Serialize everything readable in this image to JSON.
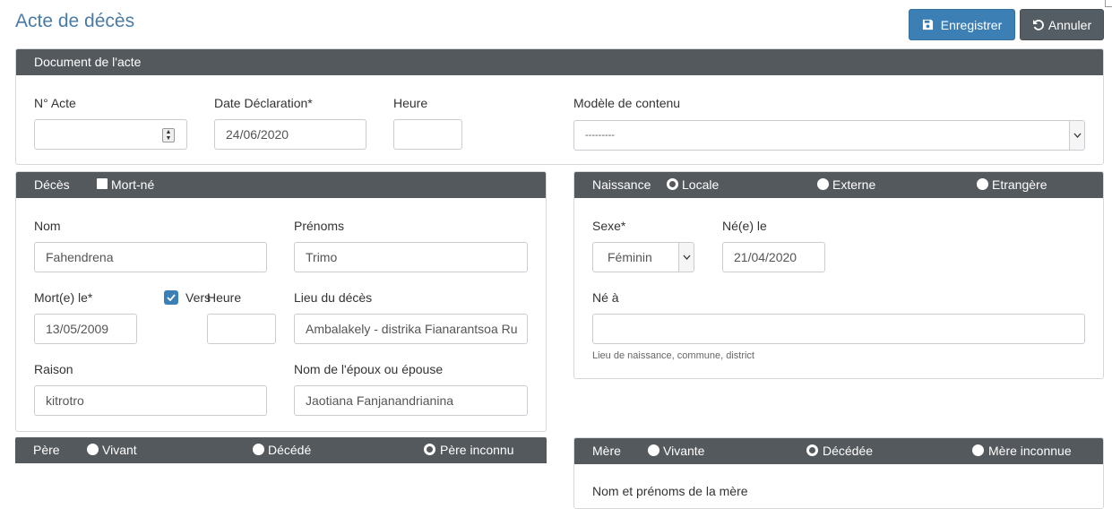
{
  "header": {
    "title": "Acte de décès",
    "save_label": "Enregistrer",
    "cancel_label": "Annuler"
  },
  "document_panel": {
    "title": "Document de l'acte",
    "num_acte_label": "N° Acte",
    "num_acte_value": "",
    "date_label": "Date Déclaration*",
    "date_value": "24/06/2020",
    "heure_label": "Heure",
    "heure_value": "",
    "modele_label": "Modèle de contenu",
    "modele_value": "---------"
  },
  "deces_panel": {
    "title": "Décès",
    "mort_ne_label": "Mort-né",
    "nom_label": "Nom",
    "nom_value": "Fahendrena",
    "prenoms_label": "Prénoms",
    "prenoms_value": "Trimo",
    "mort_le_label": "Mort(e) le*",
    "mort_le_value": "13/05/2009",
    "vers_label": "Vers",
    "heure_label": "Heure",
    "heure_value": "",
    "lieu_label": "Lieu du décès",
    "lieu_value": "Ambalakely - distrika Fianarantsoa Ru",
    "raison_label": "Raison",
    "raison_value": "kitrotro",
    "epoux_label": "Nom de l'époux ou épouse",
    "epoux_value": "Jaotiana Fanjanandrianina"
  },
  "naissance_panel": {
    "title": "Naissance",
    "radio_locale": "Locale",
    "radio_externe": "Externe",
    "radio_etrangere": "Etrangère",
    "sexe_label": "Sexe*",
    "sexe_value": "Féminin",
    "ne_le_label": "Né(e) le",
    "ne_le_value": "21/04/2020",
    "ne_a_label": "Né à",
    "ne_a_value": "",
    "ne_a_help": "Lieu de naissance, commune, district"
  },
  "pere_bar": {
    "title": "Père",
    "vivant": "Vivant",
    "decede": "Décédé",
    "inconnu": "Père inconnu"
  },
  "mere_panel": {
    "title": "Mère",
    "vivante": "Vivante",
    "decedee": "Décédée",
    "inconnue": "Mère inconnue",
    "nom_label": "Nom et prénoms de la mère"
  },
  "colors": {
    "accent": "#3c7fb5",
    "header_bar": "#54595e",
    "title": "#4a7ba6"
  }
}
